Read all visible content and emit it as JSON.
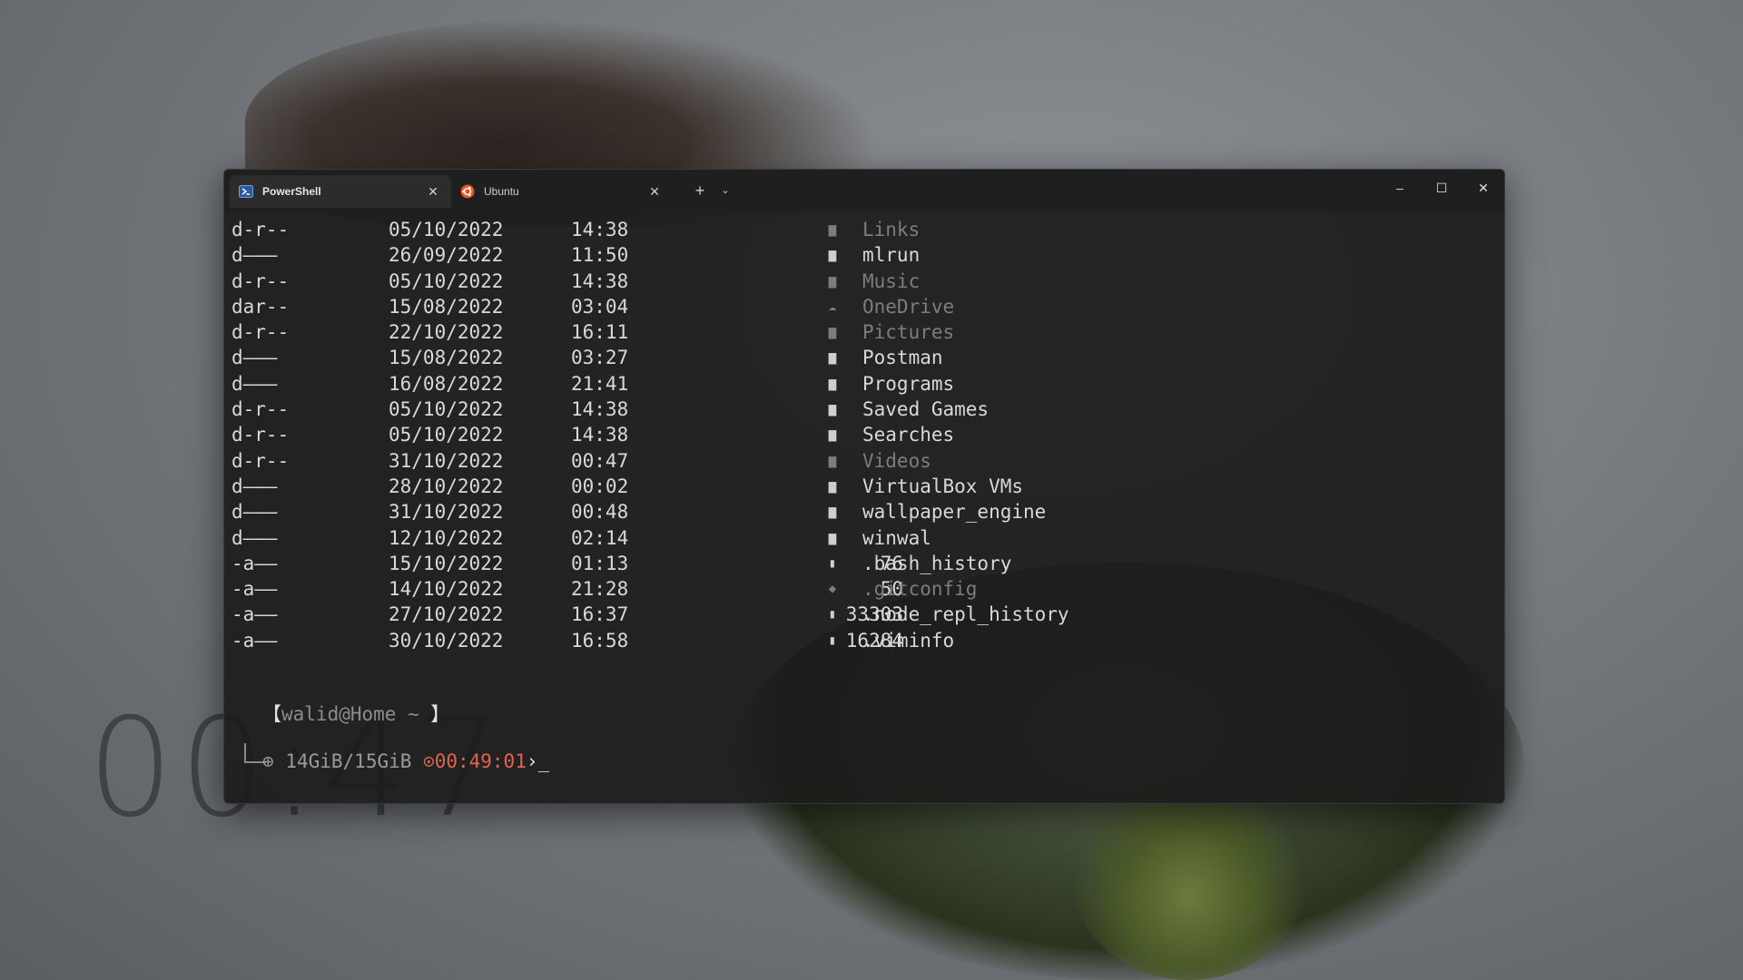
{
  "tabs": [
    {
      "label": "PowerShell",
      "icon": "powershell-icon",
      "active": true
    },
    {
      "label": "Ubuntu",
      "icon": "ubuntu-icon",
      "active": false
    }
  ],
  "tab_controls": {
    "new_tab": "+",
    "dropdown": "⌄"
  },
  "window_controls": {
    "minimize": "–",
    "maximize": "☐",
    "close": "✕"
  },
  "colors": {
    "ubuntu": "#e95420",
    "prompt_time": "#e0634e",
    "dim_text": "#7d7d7d"
  },
  "listing": [
    {
      "mode": "d-r--",
      "date": "05/10/2022",
      "time": "14:38",
      "size": "",
      "icon": "link-folder-icon",
      "name": "Links",
      "dim": true
    },
    {
      "mode": "d———",
      "date": "26/09/2022",
      "time": "11:50",
      "size": "",
      "icon": "folder-icon",
      "name": "mlrun",
      "dim": false
    },
    {
      "mode": "d-r--",
      "date": "05/10/2022",
      "time": "14:38",
      "size": "",
      "icon": "music-folder-icon",
      "name": "Music",
      "dim": true
    },
    {
      "mode": "dar--",
      "date": "15/08/2022",
      "time": "03:04",
      "size": "",
      "icon": "cloud-icon",
      "name": "OneDrive",
      "dim": true
    },
    {
      "mode": "d-r--",
      "date": "22/10/2022",
      "time": "16:11",
      "size": "",
      "icon": "pictures-folder-icon",
      "name": "Pictures",
      "dim": true
    },
    {
      "mode": "d———",
      "date": "15/08/2022",
      "time": "03:27",
      "size": "",
      "icon": "folder-icon",
      "name": "Postman",
      "dim": false
    },
    {
      "mode": "d———",
      "date": "16/08/2022",
      "time": "21:41",
      "size": "",
      "icon": "folder-icon",
      "name": "Programs",
      "dim": false
    },
    {
      "mode": "d-r--",
      "date": "05/10/2022",
      "time": "14:38",
      "size": "",
      "icon": "folder-icon",
      "name": "Saved Games",
      "dim": false
    },
    {
      "mode": "d-r--",
      "date": "05/10/2022",
      "time": "14:38",
      "size": "",
      "icon": "folder-icon",
      "name": "Searches",
      "dim": false
    },
    {
      "mode": "d-r--",
      "date": "31/10/2022",
      "time": "00:47",
      "size": "",
      "icon": "video-folder-icon",
      "name": "Videos",
      "dim": true
    },
    {
      "mode": "d———",
      "date": "28/10/2022",
      "time": "00:02",
      "size": "",
      "icon": "folder-icon",
      "name": "VirtualBox VMs",
      "dim": false
    },
    {
      "mode": "d———",
      "date": "31/10/2022",
      "time": "00:48",
      "size": "",
      "icon": "folder-icon",
      "name": "wallpaper_engine",
      "dim": false
    },
    {
      "mode": "d———",
      "date": "12/10/2022",
      "time": "02:14",
      "size": "",
      "icon": "folder-icon",
      "name": "winwal",
      "dim": false
    },
    {
      "mode": "-a——",
      "date": "15/10/2022",
      "time": "01:13",
      "size": "76",
      "icon": "file-icon",
      "name": ".bash_history",
      "dim": false
    },
    {
      "mode": "-a——",
      "date": "14/10/2022",
      "time": "21:28",
      "size": "50",
      "icon": "git-icon",
      "name": ".gitconfig",
      "dim": true
    },
    {
      "mode": "-a——",
      "date": "27/10/2022",
      "time": "16:37",
      "size": "33303",
      "icon": "file-icon",
      "name": ".node_repl_history",
      "dim": false
    },
    {
      "mode": "-a——",
      "date": "30/10/2022",
      "time": "16:58",
      "size": "16284",
      "icon": "file-icon",
      "name": ".viminfo",
      "dim": false
    }
  ],
  "prompt": {
    "open_bracket": "【",
    "user_host": "walid@Home",
    "path": "~",
    "close_bracket": "】",
    "memory_icon": "memory-icon",
    "memory": "14GiB/15GiB",
    "clock_icon": "clock-icon",
    "elapsed": "00:49:01",
    "arrow": "›",
    "cursor": "_"
  },
  "wallpaper": {
    "clock_text": "00:47"
  }
}
